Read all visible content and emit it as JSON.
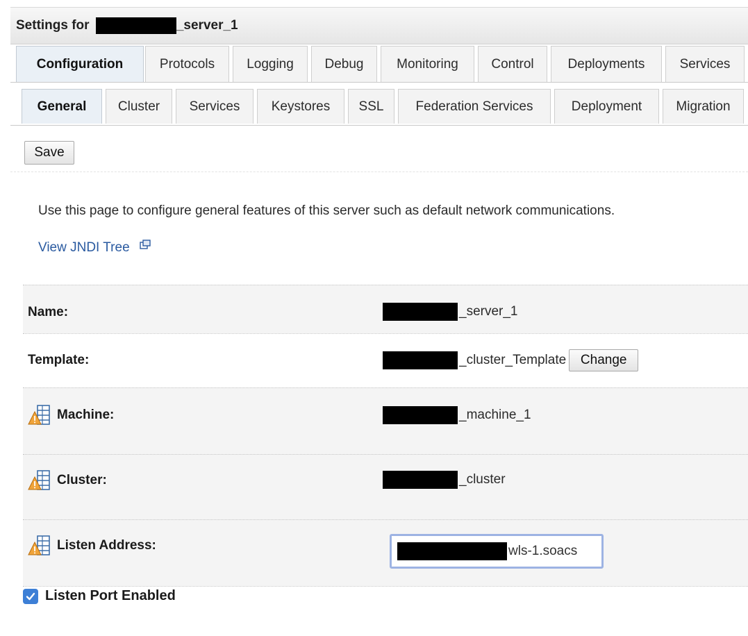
{
  "window": {
    "title_prefix": "Settings for",
    "title_suffix": "_server_1"
  },
  "primary_tabs": [
    {
      "label": "Configuration",
      "active": true
    },
    {
      "label": "Protocols",
      "active": false
    },
    {
      "label": "Logging",
      "active": false
    },
    {
      "label": "Debug",
      "active": false
    },
    {
      "label": "Monitoring",
      "active": false
    },
    {
      "label": "Control",
      "active": false
    },
    {
      "label": "Deployments",
      "active": false
    },
    {
      "label": "Services",
      "active": false
    }
  ],
  "secondary_tabs": [
    {
      "label": "General",
      "active": true
    },
    {
      "label": "Cluster",
      "active": false
    },
    {
      "label": "Services",
      "active": false
    },
    {
      "label": "Keystores",
      "active": false
    },
    {
      "label": "SSL",
      "active": false
    },
    {
      "label": "Federation Services",
      "active": false
    },
    {
      "label": "Deployment",
      "active": false
    },
    {
      "label": "Migration",
      "active": false
    }
  ],
  "toolbar": {
    "save_label": "Save"
  },
  "description": "Use this page to configure general features of this server such as default network communications.",
  "jndi_link": {
    "label": "View JNDI Tree",
    "icon": "external-link-icon"
  },
  "fields": {
    "name": {
      "label": "Name:",
      "value": "_server_1"
    },
    "template": {
      "label": "Template:",
      "value": "_cluster_Template",
      "button": "Change"
    },
    "machine": {
      "label": "Machine:",
      "value": "_machine_1",
      "icon": "config-change-warning-icon"
    },
    "cluster": {
      "label": "Cluster:",
      "value": "_cluster",
      "icon": "config-change-warning-icon"
    },
    "listen_address": {
      "label": "Listen Address:",
      "value": "wls-1.soacs",
      "icon": "config-change-warning-icon"
    }
  },
  "listen_port_enabled": {
    "label": "Listen Port Enabled",
    "checked": true
  },
  "colors": {
    "link": "#2a5aa0",
    "checkbox": "#3d7fd6",
    "input_focus": "#9db3e3"
  }
}
